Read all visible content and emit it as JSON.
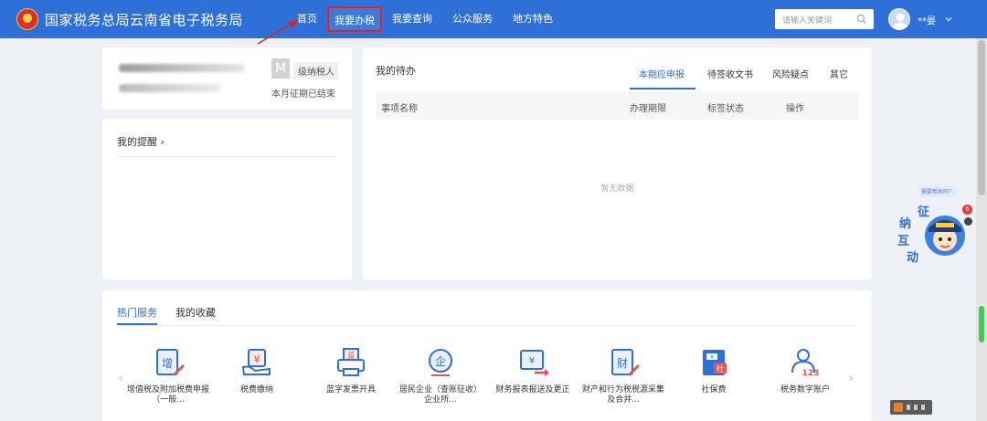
{
  "header": {
    "title": "国家税务总局云南省电子税务局",
    "nav": [
      {
        "label": "首页",
        "active": false
      },
      {
        "label": "我要办税",
        "active": true
      },
      {
        "label": "我要查询",
        "active": false
      },
      {
        "label": "公众服务",
        "active": false
      },
      {
        "label": "地方特色",
        "active": false
      }
    ],
    "search_placeholder": "请输入关键词",
    "username": "**晏"
  },
  "profile": {
    "taxpayer_level_letter": "M",
    "taxpayer_level_text": "级纳税人",
    "period_status": "本月征期已结束"
  },
  "reminders": {
    "title": "我的提醒 ›"
  },
  "todo": {
    "title": "我的待办",
    "tabs": [
      "本期应申报",
      "待签收文书",
      "风险疑点",
      "其它"
    ],
    "active_tab": 0,
    "columns": [
      "事项名称",
      "办理期限",
      "标签状态",
      "操作"
    ],
    "empty_text": "暂无数据"
  },
  "services": {
    "tabs": [
      "热门服务",
      "我的收藏"
    ],
    "active_tab": 0,
    "items": [
      {
        "label": "增值税及附加税费申报（一般...",
        "icon": "vat-declare-icon",
        "glyph": "增"
      },
      {
        "label": "税费缴纳",
        "icon": "tax-payment-icon",
        "glyph": "¥"
      },
      {
        "label": "蓝字发票开具",
        "icon": "invoice-print-icon",
        "glyph": "蓝"
      },
      {
        "label": "居民企业（查账征收）企业所...",
        "icon": "enterprise-income-icon",
        "glyph": "企"
      },
      {
        "label": "财务报表报送及更正",
        "icon": "financial-report-icon",
        "glyph": "¥"
      },
      {
        "label": "财产和行为税税源采集及合并...",
        "icon": "property-tax-icon",
        "glyph": "财"
      },
      {
        "label": "社保费",
        "icon": "social-security-icon",
        "glyph": "社"
      },
      {
        "label": "税务数字账户",
        "icon": "digital-account-icon",
        "glyph": "123"
      }
    ]
  },
  "assistant": {
    "bubble": "需要帮助吗？",
    "chars": [
      "征",
      "纳",
      "互",
      "动"
    ],
    "notification_count": "6"
  },
  "colors": {
    "primary": "#2f6fd8",
    "highlight_border": "#e02323",
    "page_bg": "#eef1f6"
  }
}
